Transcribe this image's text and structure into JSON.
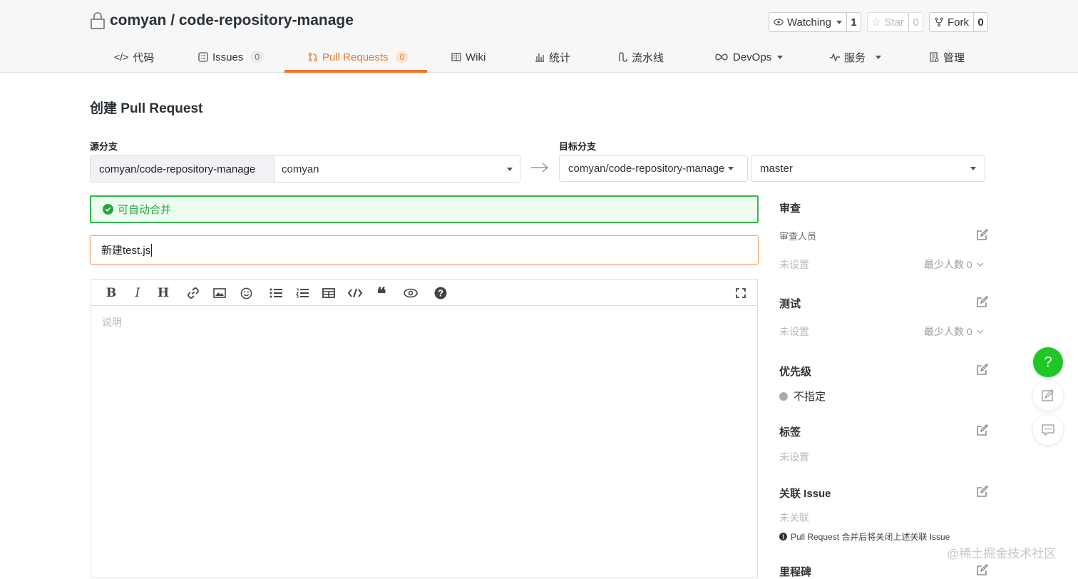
{
  "repo": {
    "title": "comyan / code-repository-manage"
  },
  "actions": {
    "watching": {
      "label": "Watching",
      "count": "1"
    },
    "star": {
      "label": "Star",
      "count": "0"
    },
    "fork": {
      "label": "Fork",
      "count": "0"
    }
  },
  "tabs": [
    {
      "label": "代码",
      "icon": "code-icon"
    },
    {
      "label": "Issues",
      "badge": "0",
      "icon": "issue-icon"
    },
    {
      "label": "Pull Requests",
      "badge": "0",
      "icon": "pull-request-icon",
      "active": true
    },
    {
      "label": "Wiki",
      "icon": "book-icon"
    },
    {
      "label": "统计",
      "icon": "bar-chart-icon"
    },
    {
      "label": "流水线",
      "icon": "pipeline-icon"
    },
    {
      "label": "DevOps",
      "icon": "infinity-icon"
    },
    {
      "label": "服务",
      "icon": "pulse-icon"
    },
    {
      "label": "管理",
      "icon": "settings-doc-icon"
    }
  ],
  "page": {
    "title": "创建 Pull Request"
  },
  "source": {
    "label": "源分支",
    "repo": "comyan/code-repository-manage",
    "branch": "comyan"
  },
  "target": {
    "label": "目标分支",
    "repo": "comyan/code-repository-manage",
    "branch": "master"
  },
  "merge_status": "可自动合并",
  "pr_title": "新建test.js",
  "editor": {
    "placeholder": "说明"
  },
  "sidebar": {
    "review": {
      "heading": "审查",
      "reviewers_label": "审查人员",
      "unset": "未设置",
      "min_people": "最少人数 0"
    },
    "test": {
      "heading": "测试",
      "unset": "未设置",
      "min_people": "最少人数 0"
    },
    "priority": {
      "heading": "优先级",
      "value": "不指定"
    },
    "labels": {
      "heading": "标签",
      "unset": "未设置"
    },
    "issue": {
      "heading": "关联 Issue",
      "unset": "未关联",
      "note": "Pull Request 合并后将关闭上述关联 Issue"
    },
    "milestone": {
      "heading": "里程碑"
    }
  },
  "floating": {
    "help": "?"
  },
  "watermark": "@稀土掘金技术社区",
  "colors": {
    "accent": "#f5732a",
    "success": "#26a641",
    "help_button": "#1ec724"
  }
}
